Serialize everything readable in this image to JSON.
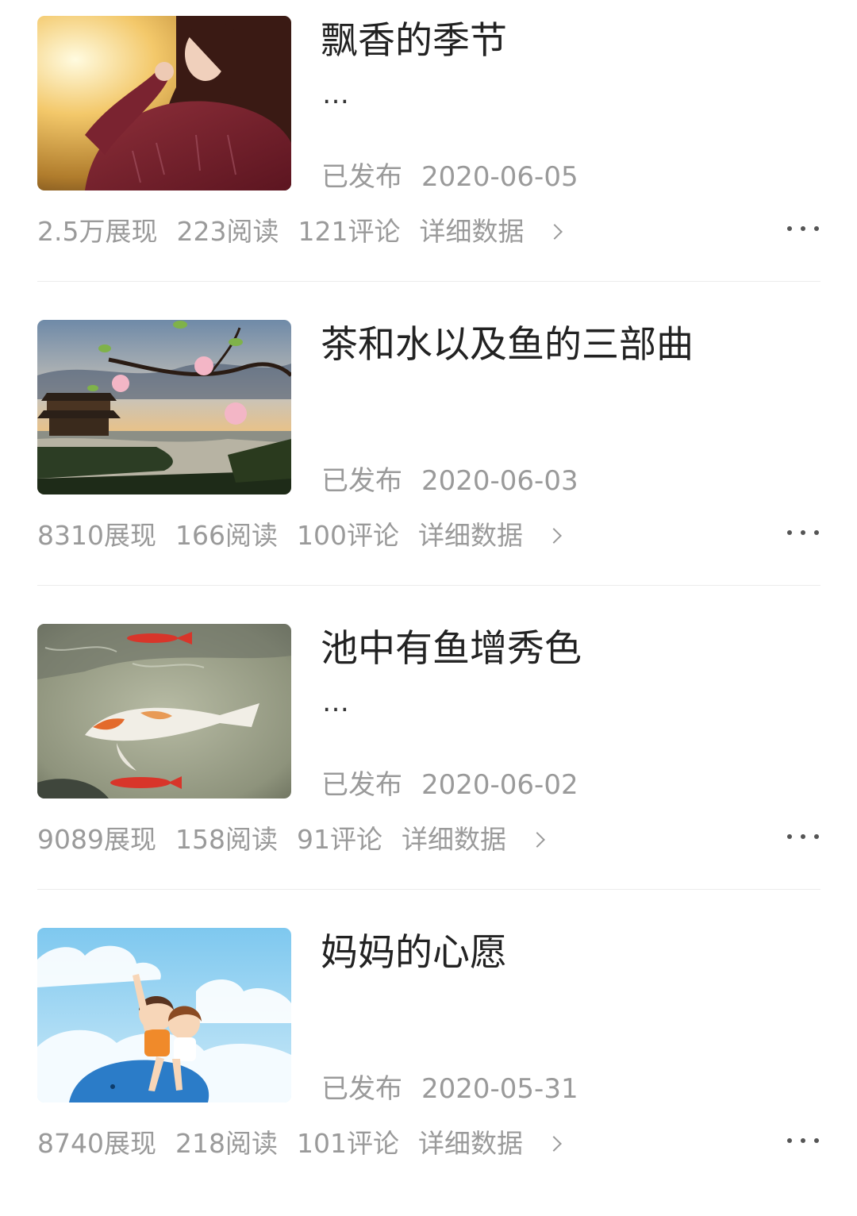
{
  "articles": [
    {
      "title": "飘香的季节",
      "ellipsis": "…",
      "status": "已发布",
      "date": "2020-06-05",
      "impressions": "2.5万展现",
      "reads": "223阅读",
      "comments": "121评论",
      "detail_link": "详细数据",
      "thumbnail": "woman-red-blouse-photo"
    },
    {
      "title": "茶和水以及鱼的三部曲",
      "ellipsis": "",
      "status": "已发布",
      "date": "2020-06-03",
      "impressions": "8310展现",
      "reads": "166阅读",
      "comments": "100评论",
      "detail_link": "详细数据",
      "thumbnail": "pavilion-lake-blossom-photo"
    },
    {
      "title": "池中有鱼增秀色",
      "ellipsis": "…",
      "status": "已发布",
      "date": "2020-06-02",
      "impressions": "9089展现",
      "reads": "158阅读",
      "comments": "91评论",
      "detail_link": "详细数据",
      "thumbnail": "koi-pond-photo"
    },
    {
      "title": "妈妈的心愿",
      "ellipsis": "",
      "status": "已发布",
      "date": "2020-05-31",
      "impressions": "8740展现",
      "reads": "218阅读",
      "comments": "101评论",
      "detail_link": "详细数据",
      "thumbnail": "children-cartoon-illustration"
    }
  ],
  "icons": {
    "detail": "chevron-right-icon",
    "more": "more-dots-icon"
  },
  "colors": {
    "title": "#222222",
    "meta": "#9a9a9a",
    "divider": "#ececec"
  }
}
